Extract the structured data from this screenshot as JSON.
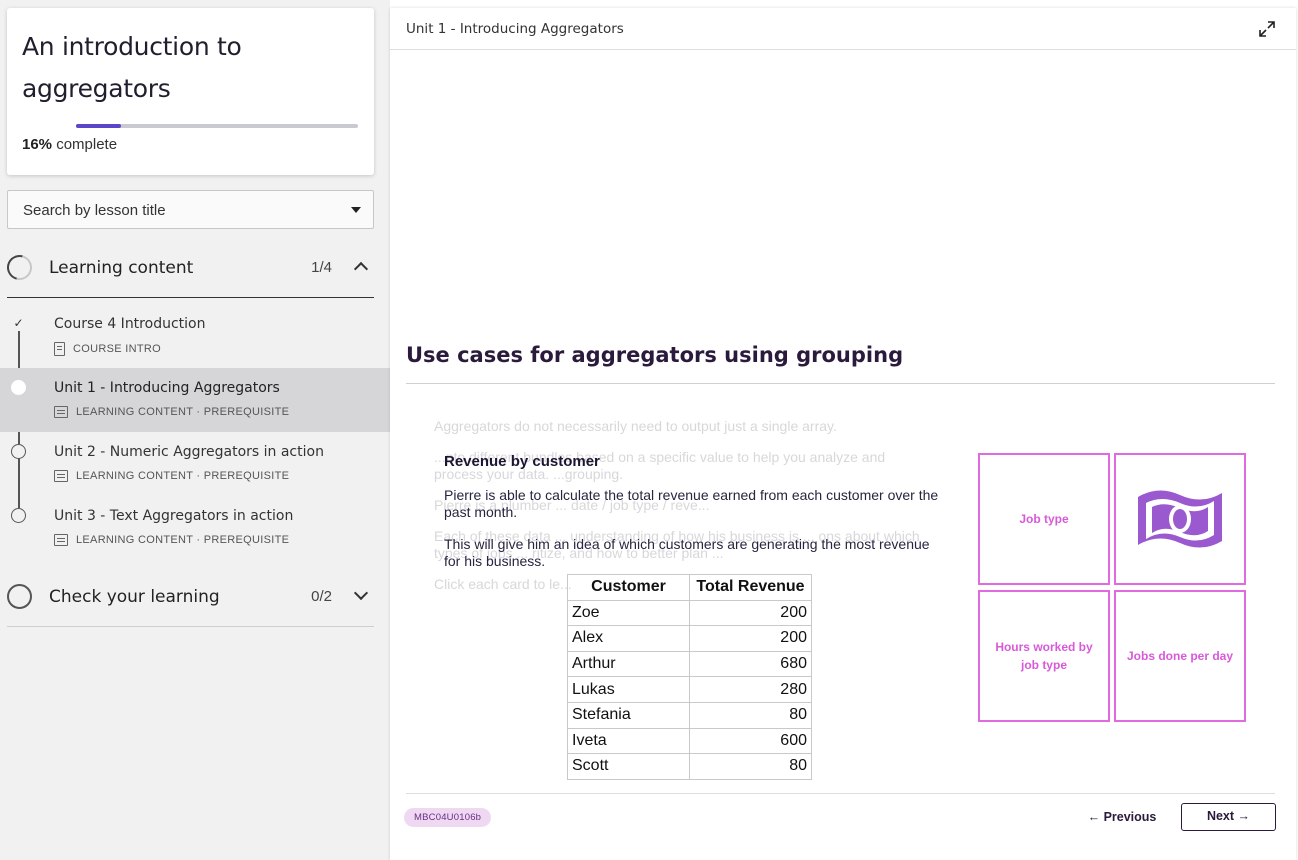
{
  "course": {
    "title": "An introduction to aggregators",
    "progress_percent": 16,
    "progress_label": "16%",
    "progress_suffix": "complete"
  },
  "search": {
    "label": "Search by lesson title"
  },
  "sections": {
    "learning": {
      "title": "Learning content",
      "count": "1/4"
    },
    "check": {
      "title": "Check your learning",
      "count": "0/2"
    }
  },
  "lessons": [
    {
      "title": "Course 4 Introduction",
      "meta": "COURSE INTRO",
      "status": "completed"
    },
    {
      "title": "Unit 1 - Introducing Aggregators",
      "meta": "LEARNING CONTENT · PREREQUISITE",
      "status": "current"
    },
    {
      "title": "Unit 2 - Numeric Aggregators in action",
      "meta": "LEARNING CONTENT · PREREQUISITE",
      "status": "not-started"
    },
    {
      "title": "Unit 3 - Text Aggregators in action",
      "meta": "LEARNING CONTENT · PREREQUISITE",
      "status": "not-started"
    }
  ],
  "main": {
    "unit_title": "Unit 1 - Introducing Aggregators",
    "heading": "Use cases for aggregators using grouping",
    "background_text": [
      "Aggregators do not necessarily need to output just a single array.",
      "...nto different bundles based on a specific value to help you analyze and process your data. ...grouping.",
      "Pierre is a plumber ... date / job type / reve...",
      "Each of these data ... understanding of how his business is ... ons about which types of jobs ... ritize, and how to better plan ...",
      "Click each card to le..."
    ],
    "popup": {
      "title": "Revenue by customer",
      "paragraph1": "Pierre is able to calculate the total revenue earned from each customer over the past month.",
      "paragraph2": "This will give him an idea of which customers are generating the most revenue for his business."
    },
    "table": {
      "headers": [
        "Customer",
        "Total Revenue"
      ],
      "rows": [
        [
          "Zoe",
          "200"
        ],
        [
          "Alex",
          "200"
        ],
        [
          "Arthur",
          "680"
        ],
        [
          "Lukas",
          "280"
        ],
        [
          "Stefania",
          "80"
        ],
        [
          "Iveta",
          "600"
        ],
        [
          "Scott",
          "80"
        ]
      ]
    },
    "cards": {
      "job_type": "Job type",
      "money_icon": "money-bill-icon",
      "hours_worked": "Hours worked by job type",
      "jobs_done": "Jobs done per day"
    },
    "footer": {
      "code": "MBC04U0106b",
      "previous": "Previous",
      "next": "Next"
    }
  },
  "colors": {
    "accent": "#5b46c7",
    "card_border": "#e06ae0",
    "card_text": "#d85ad8",
    "money_icon": "#9b59d0",
    "badge_bg": "#efd9f2"
  }
}
